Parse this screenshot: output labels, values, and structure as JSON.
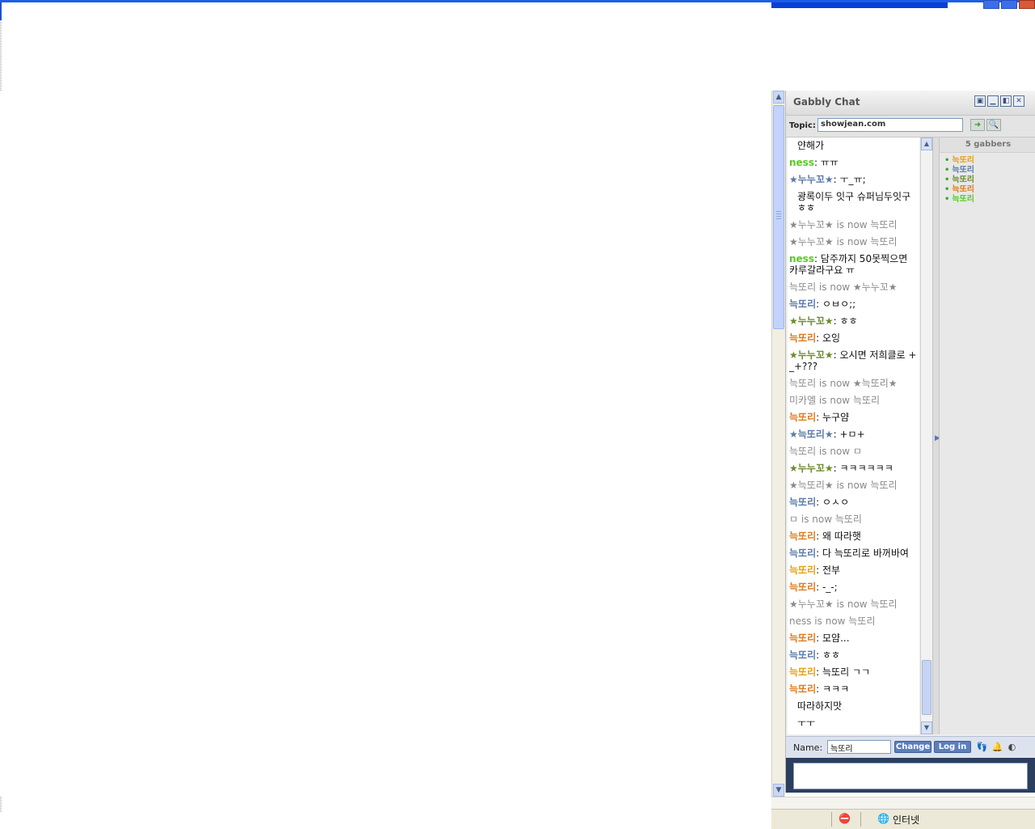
{
  "colors": {
    "nick_green": "#55cc22",
    "nick_blue": "#5b7aa8",
    "nick_olive": "#6a8a2a",
    "nick_orange": "#e07a1a",
    "nick_gold": "#e6a012",
    "system_gray": "#8a8a8a"
  },
  "chat": {
    "title": "Gabbly Chat",
    "topic_label": "Topic:",
    "topic_value": "showjean.com",
    "users_header": "5 gabbers",
    "users": [
      {
        "name": "늑또리",
        "color": "#e6a012"
      },
      {
        "name": "늑또리",
        "color": "#5b7aa8"
      },
      {
        "name": "늑또리",
        "color": "#6a8a2a"
      },
      {
        "name": "늑또리",
        "color": "#e07a1a"
      },
      {
        "name": "늑또리",
        "color": "#55cc22"
      }
    ],
    "messages": [
      {
        "nick": "",
        "sep": "",
        "text": "얀해가",
        "type": "cont"
      },
      {
        "nick": "ness",
        "sep": ": ",
        "text": "ㅠㅠ",
        "color": "#55cc22"
      },
      {
        "nick": "★누누꼬★",
        "sep": ": ",
        "text": "ㅜ_ㅠ;",
        "color": "#5b7aa8"
      },
      {
        "nick": "",
        "sep": "",
        "text": "광록이두 잇구 슈퍼님두잇구 ㅎㅎ",
        "type": "cont"
      },
      {
        "nick": "",
        "sep": "",
        "text": "★누누꼬★ is now 늑또리",
        "type": "sys"
      },
      {
        "nick": "",
        "sep": "",
        "text": "★누누꼬★ is now 늑또리",
        "type": "sys"
      },
      {
        "nick": "ness",
        "sep": ": ",
        "text": "담주까지 50못찍으면 카루갈라구요 ㅠ",
        "color": "#55cc22"
      },
      {
        "nick": "",
        "sep": "",
        "text": "늑또리 is now ★누누꼬★",
        "type": "sys"
      },
      {
        "nick": "늑또리",
        "sep": ": ",
        "text": "ㅇㅂㅇ;;",
        "color": "#5b7aa8"
      },
      {
        "nick": "★누누꼬★",
        "sep": ": ",
        "text": "ㅎㅎ",
        "color": "#6a8a2a"
      },
      {
        "nick": "늑또리",
        "sep": ": ",
        "text": "오잉",
        "color": "#e07a1a"
      },
      {
        "nick": "★누누꼬★",
        "sep": ": ",
        "text": "오시면 저희클로 +_+???",
        "color": "#6a8a2a"
      },
      {
        "nick": "",
        "sep": "",
        "text": "늑또리 is now ★늑또리★",
        "type": "sys"
      },
      {
        "nick": "",
        "sep": "",
        "text": "미카엘 is now 늑또리",
        "type": "sys"
      },
      {
        "nick": "늑또리",
        "sep": ": ",
        "text": "누구얌",
        "color": "#e07a1a"
      },
      {
        "nick": "★늑또리★",
        "sep": ": ",
        "text": "+ㅁ+",
        "color": "#5b7aa8"
      },
      {
        "nick": "",
        "sep": "",
        "text": "늑또리 is now ㅁ",
        "type": "sys"
      },
      {
        "nick": "★누누꼬★",
        "sep": ": ",
        "text": "ㅋㅋㅋㅋㅋㅋ",
        "color": "#6a8a2a"
      },
      {
        "nick": "",
        "sep": "",
        "text": "★늑또리★ is now 늑또리",
        "type": "sys"
      },
      {
        "nick": "늑또리",
        "sep": ": ",
        "text": "ㅇㅅㅇ",
        "color": "#5b7aa8"
      },
      {
        "nick": "",
        "sep": "",
        "text": "ㅁ is now 늑또리",
        "type": "sys"
      },
      {
        "nick": "늑또리",
        "sep": ": ",
        "text": "왜 따라햇",
        "color": "#e07a1a"
      },
      {
        "nick": "늑또리",
        "sep": ": ",
        "text": "다 늑또리로 바꺼바여",
        "color": "#5b7aa8"
      },
      {
        "nick": "늑또리",
        "sep": ": ",
        "text": "전부",
        "color": "#e6a012"
      },
      {
        "nick": "늑또리",
        "sep": ": ",
        "text": "-_-;",
        "color": "#e07a1a"
      },
      {
        "nick": "",
        "sep": "",
        "text": "★누누꼬★ is now 늑또리",
        "type": "sys"
      },
      {
        "nick": "",
        "sep": "",
        "text": "ness is now 늑또리",
        "type": "sys"
      },
      {
        "nick": "늑또리",
        "sep": ": ",
        "text": "모얌...",
        "color": "#e07a1a"
      },
      {
        "nick": "늑또리",
        "sep": ": ",
        "text": "ㅎㅎ",
        "color": "#5b7aa8"
      },
      {
        "nick": "늑또리",
        "sep": ": ",
        "text": "늑또리 ㄱㄱ",
        "color": "#e6a012"
      },
      {
        "nick": "늑또리",
        "sep": ": ",
        "text": "ㅋㅋㅋ",
        "color": "#e07a1a"
      },
      {
        "nick": "",
        "sep": "",
        "text": "따라하지맛",
        "type": "cont"
      },
      {
        "nick": "",
        "sep": "",
        "text": "ㅜㅜ",
        "type": "cont"
      }
    ],
    "name_label": "Name:",
    "name_value": "늑또리",
    "change_label": "Change",
    "login_label": "Log in"
  },
  "statusbar": {
    "zone_label": "인터넷"
  },
  "icons": {
    "window_minimize": "minimize-icon",
    "window_maximize": "maximize-icon",
    "window_close": "close-icon",
    "topic_go": "arrow-right-icon",
    "topic_search": "search-icon",
    "footprints": "footprints-icon",
    "bell": "bell-icon",
    "eraser": "eraser-icon",
    "popup_blocked": "popup-blocked-icon",
    "globe": "globe-icon"
  }
}
